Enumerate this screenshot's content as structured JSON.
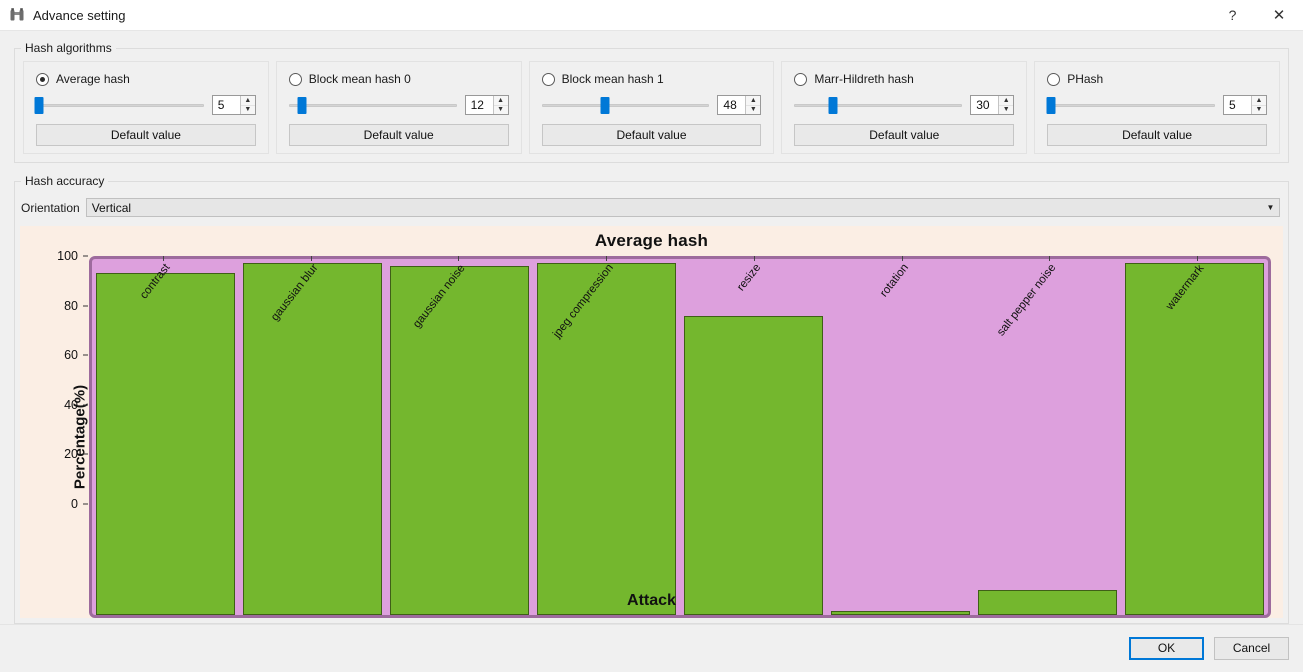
{
  "window": {
    "title": "Advance setting",
    "icon": "binoculars-icon",
    "help_label": "?",
    "close_label": "✕"
  },
  "hash_algorithms": {
    "group_title": "Hash algorithms",
    "items": [
      {
        "label": "Average hash",
        "selected": true,
        "value": "5",
        "slider_percent": 2,
        "default_button": "Default value"
      },
      {
        "label": "Block mean hash 0",
        "selected": false,
        "value": "12",
        "slider_percent": 8,
        "default_button": "Default value"
      },
      {
        "label": "Block mean hash 1",
        "selected": false,
        "value": "48",
        "slider_percent": 38,
        "default_button": "Default value"
      },
      {
        "label": "Marr-Hildreth hash",
        "selected": false,
        "value": "30",
        "slider_percent": 23,
        "default_button": "Default value"
      },
      {
        "label": "PHash",
        "selected": false,
        "value": "5",
        "slider_percent": 2,
        "default_button": "Default value"
      }
    ],
    "spin_up": "▲",
    "spin_down": "▼"
  },
  "hash_accuracy": {
    "group_title": "Hash accuracy",
    "orientation_label": "Orientation",
    "orientation_value": "Vertical",
    "dropdown_arrow": "▼"
  },
  "chart_data": {
    "type": "bar",
    "title": "Average hash",
    "xlabel": "Attack",
    "ylabel": "Percentage(%)",
    "ylim": [
      0,
      100
    ],
    "yticks": [
      0,
      20,
      40,
      60,
      80,
      100
    ],
    "grid": false,
    "legend": "none",
    "categories": [
      "contrast",
      "gaussian blur",
      "gaussian noise",
      "jpeg compression",
      "resize",
      "rotation",
      "salt pepper noise",
      "watermark"
    ],
    "values": [
      96,
      99,
      98,
      99,
      84,
      1,
      7,
      99
    ],
    "colors": {
      "bar": "#74b72e",
      "bar_edge": "#3f5f17",
      "plot_background": "#dda0dd",
      "plot_border": "#9d6b9d",
      "figure_background": "#fbeee4"
    }
  },
  "footer": {
    "ok_label": "OK",
    "cancel_label": "Cancel"
  }
}
